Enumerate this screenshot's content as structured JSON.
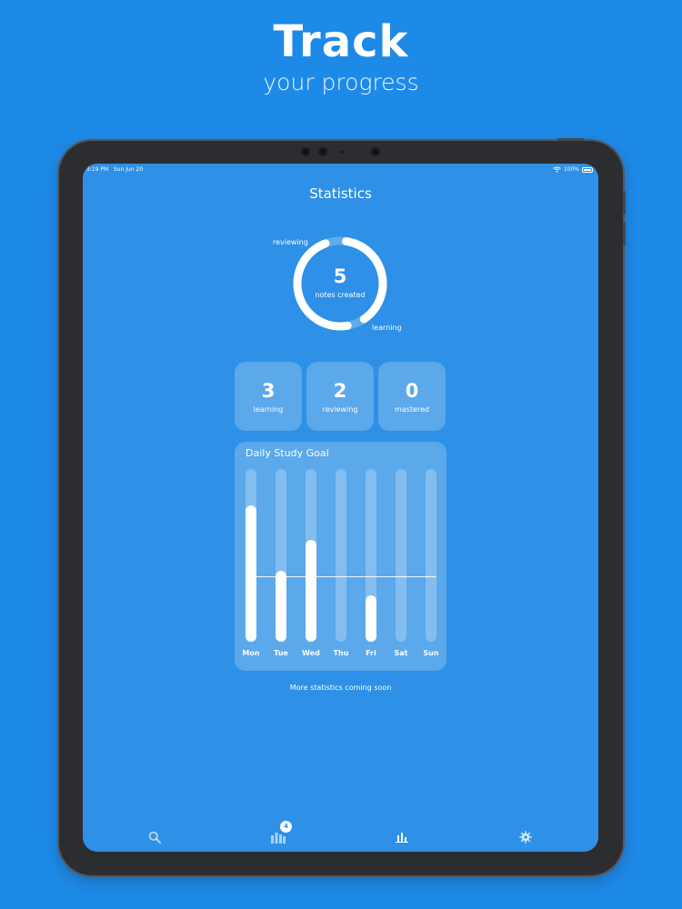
{
  "hero": {
    "title": "Track",
    "subtitle": "your progress"
  },
  "status_bar": {
    "time": "3:19 PM",
    "date": "Sun Jun 20",
    "battery": "100%",
    "icons": [
      "wifi-icon",
      "battery-icon"
    ]
  },
  "screen": {
    "title": "Statistics"
  },
  "overview": {
    "total": "5",
    "total_caption": "notes created",
    "ring_labels": {
      "top": "reviewing",
      "bottom": "learning"
    }
  },
  "stat_cards": [
    {
      "value": "3",
      "label": "learning"
    },
    {
      "value": "2",
      "label": "reviewing"
    },
    {
      "value": "0",
      "label": "mastered"
    }
  ],
  "daily_goal": {
    "title": "Daily Study Goal",
    "goal_level": 0.38,
    "days": [
      {
        "label": "Mon",
        "progress": 0.79
      },
      {
        "label": "Tue",
        "progress": 0.41
      },
      {
        "label": "Wed",
        "progress": 0.59
      },
      {
        "label": "Thu",
        "progress": 0
      },
      {
        "label": "Fri",
        "progress": 0.27
      },
      {
        "label": "Sat",
        "progress": 0
      },
      {
        "label": "Sun",
        "progress": 0
      }
    ]
  },
  "footer_note": "More statistics coming soon",
  "tabbar": {
    "items": [
      {
        "name": "search",
        "icon": "search-icon"
      },
      {
        "name": "library",
        "icon": "library-icon",
        "badge": "4"
      },
      {
        "name": "statistics",
        "icon": "bar-chart-icon"
      },
      {
        "name": "settings",
        "icon": "gear-icon"
      }
    ]
  },
  "colors": {
    "background": "#1e8ae8",
    "screen": "#2e90e6",
    "device": "#2b2d31",
    "card": "rgba(255,255,255,0.22)"
  }
}
